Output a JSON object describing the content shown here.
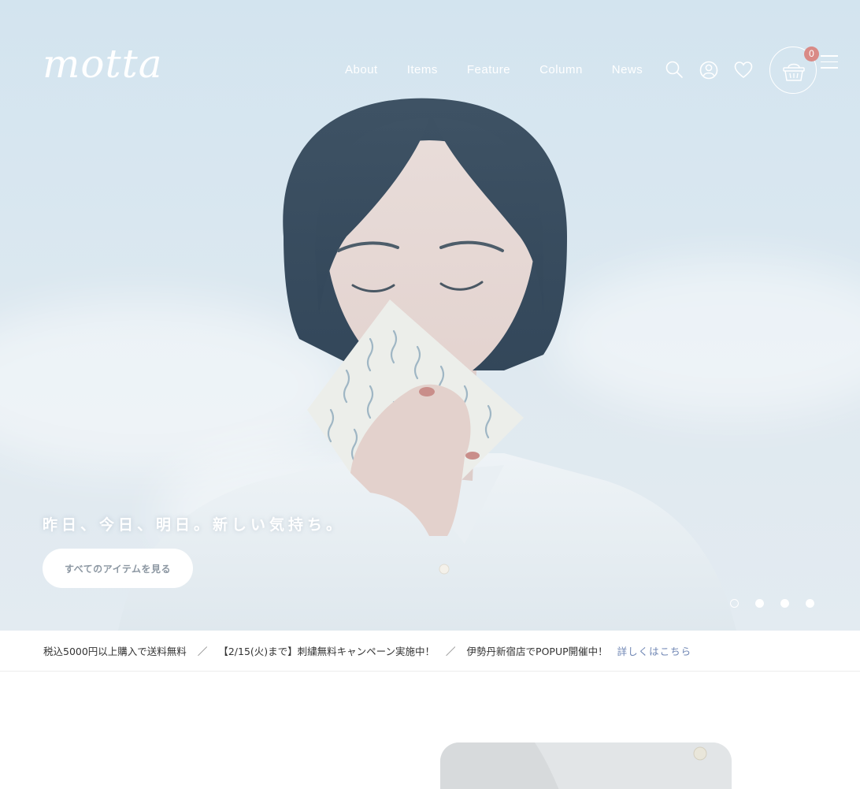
{
  "header": {
    "logo": "motta",
    "nav": [
      "About",
      "Items",
      "Feature",
      "Column",
      "News"
    ],
    "icons": [
      "search-icon",
      "account-icon",
      "heart-icon",
      "basket-icon",
      "hamburger-menu-icon"
    ],
    "cart_count": "0"
  },
  "hero": {
    "tagline": "昨日、今日、明日。新しい気持ち。",
    "cta_label": "すべてのアイテムを見る",
    "slides_total": 4,
    "active_slide": 1
  },
  "news_bar": {
    "items": [
      "税込5000円以上購入で送料無料",
      "【2/15(火)まで】刺繍無料キャンペーン実施中！",
      "伊勢丹新宿店でPOPUP開催中！"
    ],
    "separator": "／",
    "link": "詳しくはこちら"
  },
  "colors": {
    "sky": "#d3e4ef",
    "badge": "#d98a86",
    "link": "#6f86b4",
    "cta_text": "#8c97a2"
  }
}
